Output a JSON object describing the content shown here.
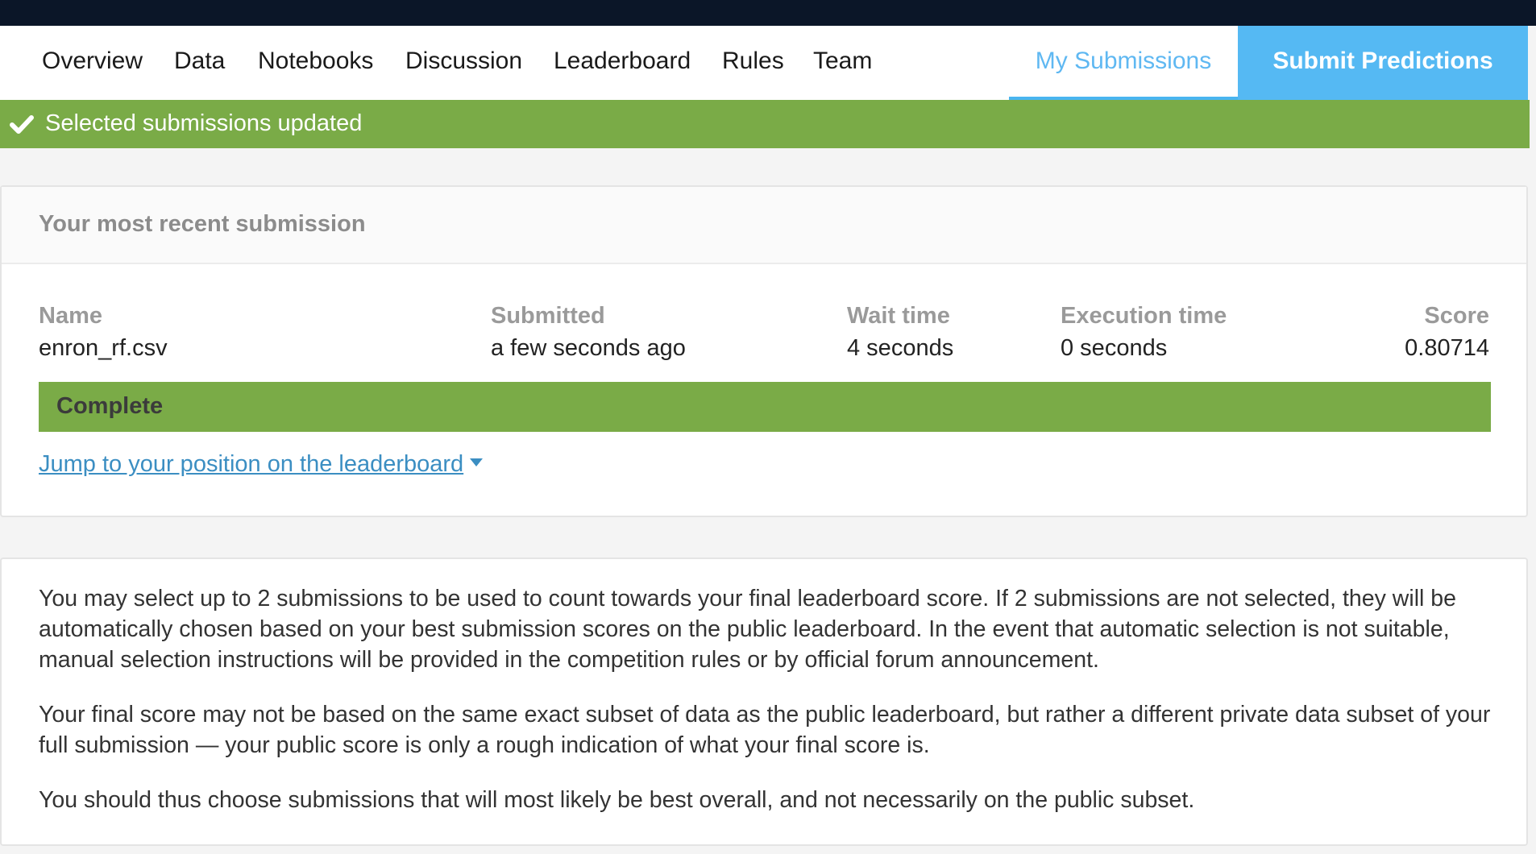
{
  "nav": {
    "items": [
      "Overview",
      "Data",
      "Notebooks",
      "Discussion",
      "Leaderboard",
      "Rules",
      "Team"
    ],
    "my_submissions": "My Submissions",
    "submit_predictions": "Submit Predictions"
  },
  "alert": {
    "icon": "check-icon",
    "message": "Selected submissions updated"
  },
  "recent": {
    "title": "Your most recent submission",
    "columns": [
      {
        "label": "Name",
        "value": "enron_rf.csv"
      },
      {
        "label": "Submitted",
        "value": "a few seconds ago"
      },
      {
        "label": "Wait time",
        "value": "4 seconds"
      },
      {
        "label": "Execution time",
        "value": "0 seconds"
      },
      {
        "label": "Score",
        "value": "0.80714"
      }
    ],
    "status": "Complete",
    "jump_link": "Jump to your position on the leaderboard"
  },
  "info": {
    "paragraphs": [
      "You may select up to 2 submissions to be used to count towards your final leaderboard score. If 2 submissions are not selected, they will be automatically chosen based on your best submission scores on the public leaderboard. In the event that automatic selection is not suitable, manual selection instructions will be provided in the competition rules or by official forum announcement.",
      "Your final score may not be based on the same exact subset of data as the public leaderboard, but rather a different private data subset of your full submission — your public score is only a rough indication of what your final score is.",
      "You should thus choose submissions that will most likely be best overall, and not necessarily on the public subset."
    ]
  },
  "colors": {
    "topbar": "#0b1628",
    "accent_blue": "#55b9f3",
    "success_green": "#7aab47",
    "link_blue": "#3b8ec2"
  }
}
